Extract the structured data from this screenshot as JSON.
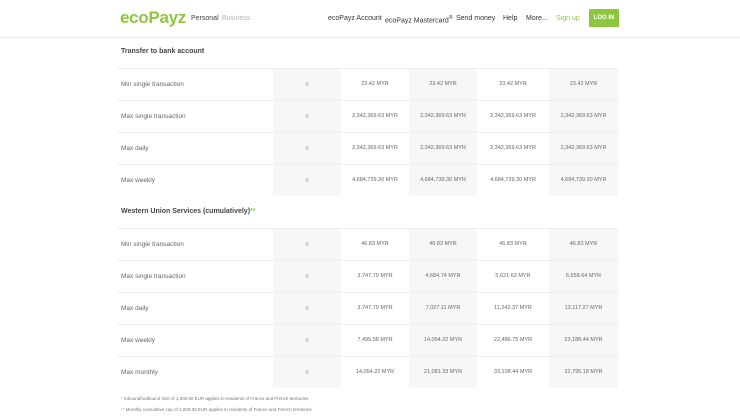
{
  "header": {
    "logo_eco": "eco",
    "logo_payz": "Payz",
    "audience": {
      "personal": "Personal",
      "business": "Business"
    },
    "nav": [
      "ecoPayz Account",
      "ecoPayz Mastercard",
      "Send money",
      "Help",
      "More..."
    ],
    "mastercard_mark": "®",
    "signup": "Sign up",
    "login": "LOG IN"
  },
  "bank": {
    "title": "Transfer to bank account",
    "rows": [
      {
        "label": "Min single transaction",
        "values": [
          "×",
          "23.42 MYR",
          "23.42 MYR",
          "23.42 MYR",
          "23.42 MYR"
        ]
      },
      {
        "label": "Max single transaction",
        "values": [
          "×",
          "2,342,369.63 MYR",
          "2,342,369.63 MYR",
          "2,342,369.63 MYR",
          "2,342,369.63 MYR"
        ]
      },
      {
        "label": "Max daily",
        "values": [
          "×",
          "2,342,369.63 MYR",
          "2,342,369.63 MYR",
          "2,342,369.63 MYR",
          "2,342,369.63 MYR"
        ]
      },
      {
        "label": "Max weekly",
        "values": [
          "×",
          "4,684,739.30 MYR",
          "4,684,739.30 MYR",
          "4,684,739.30 MYR",
          "4,684,739.30 MYR"
        ]
      }
    ]
  },
  "wu": {
    "title": "Western Union Services (cumulatively)",
    "stars": "**",
    "rows": [
      {
        "label": "Min single transaction",
        "values": [
          "×",
          "46.83 MYR",
          "46.83 MYR",
          "46.83 MYR",
          "46.83 MYR"
        ]
      },
      {
        "label": "Max single transaction",
        "values": [
          "×",
          "3,747.79 MYR",
          "4,684.74 MYR",
          "5,621.63 MYR",
          "6,558.64 MYR"
        ]
      },
      {
        "label": "Max daily",
        "values": [
          "×",
          "3,747.79 MYR",
          "7,027.11 MYR",
          "11,242.37 MYR",
          "13,117.27 MYR"
        ]
      },
      {
        "label": "Max weekly",
        "values": [
          "×",
          "7,495.58 MYR",
          "14,054.22 MYR",
          "22,486.75 MYR",
          "23,188.44 MYR"
        ]
      },
      {
        "label": "Max monthly",
        "values": [
          "×",
          "14,054.22 MYR",
          "21,081.33 MYR",
          "33,108.44 MYR",
          "32,795.18 MYR"
        ]
      }
    ]
  },
  "footnotes": {
    "f1_mark": "*",
    "f1": "Inbound/outbound limit of 1,000.00 EUR applies to residents of France and French territories",
    "f2_mark": "**",
    "f2": "Monthly cumulative cap of 1,000.00 EUR applies to residents of France and French territories"
  },
  "colors": {
    "brand_green": "#8dc63f",
    "alt_column": "#f7f7f7"
  }
}
